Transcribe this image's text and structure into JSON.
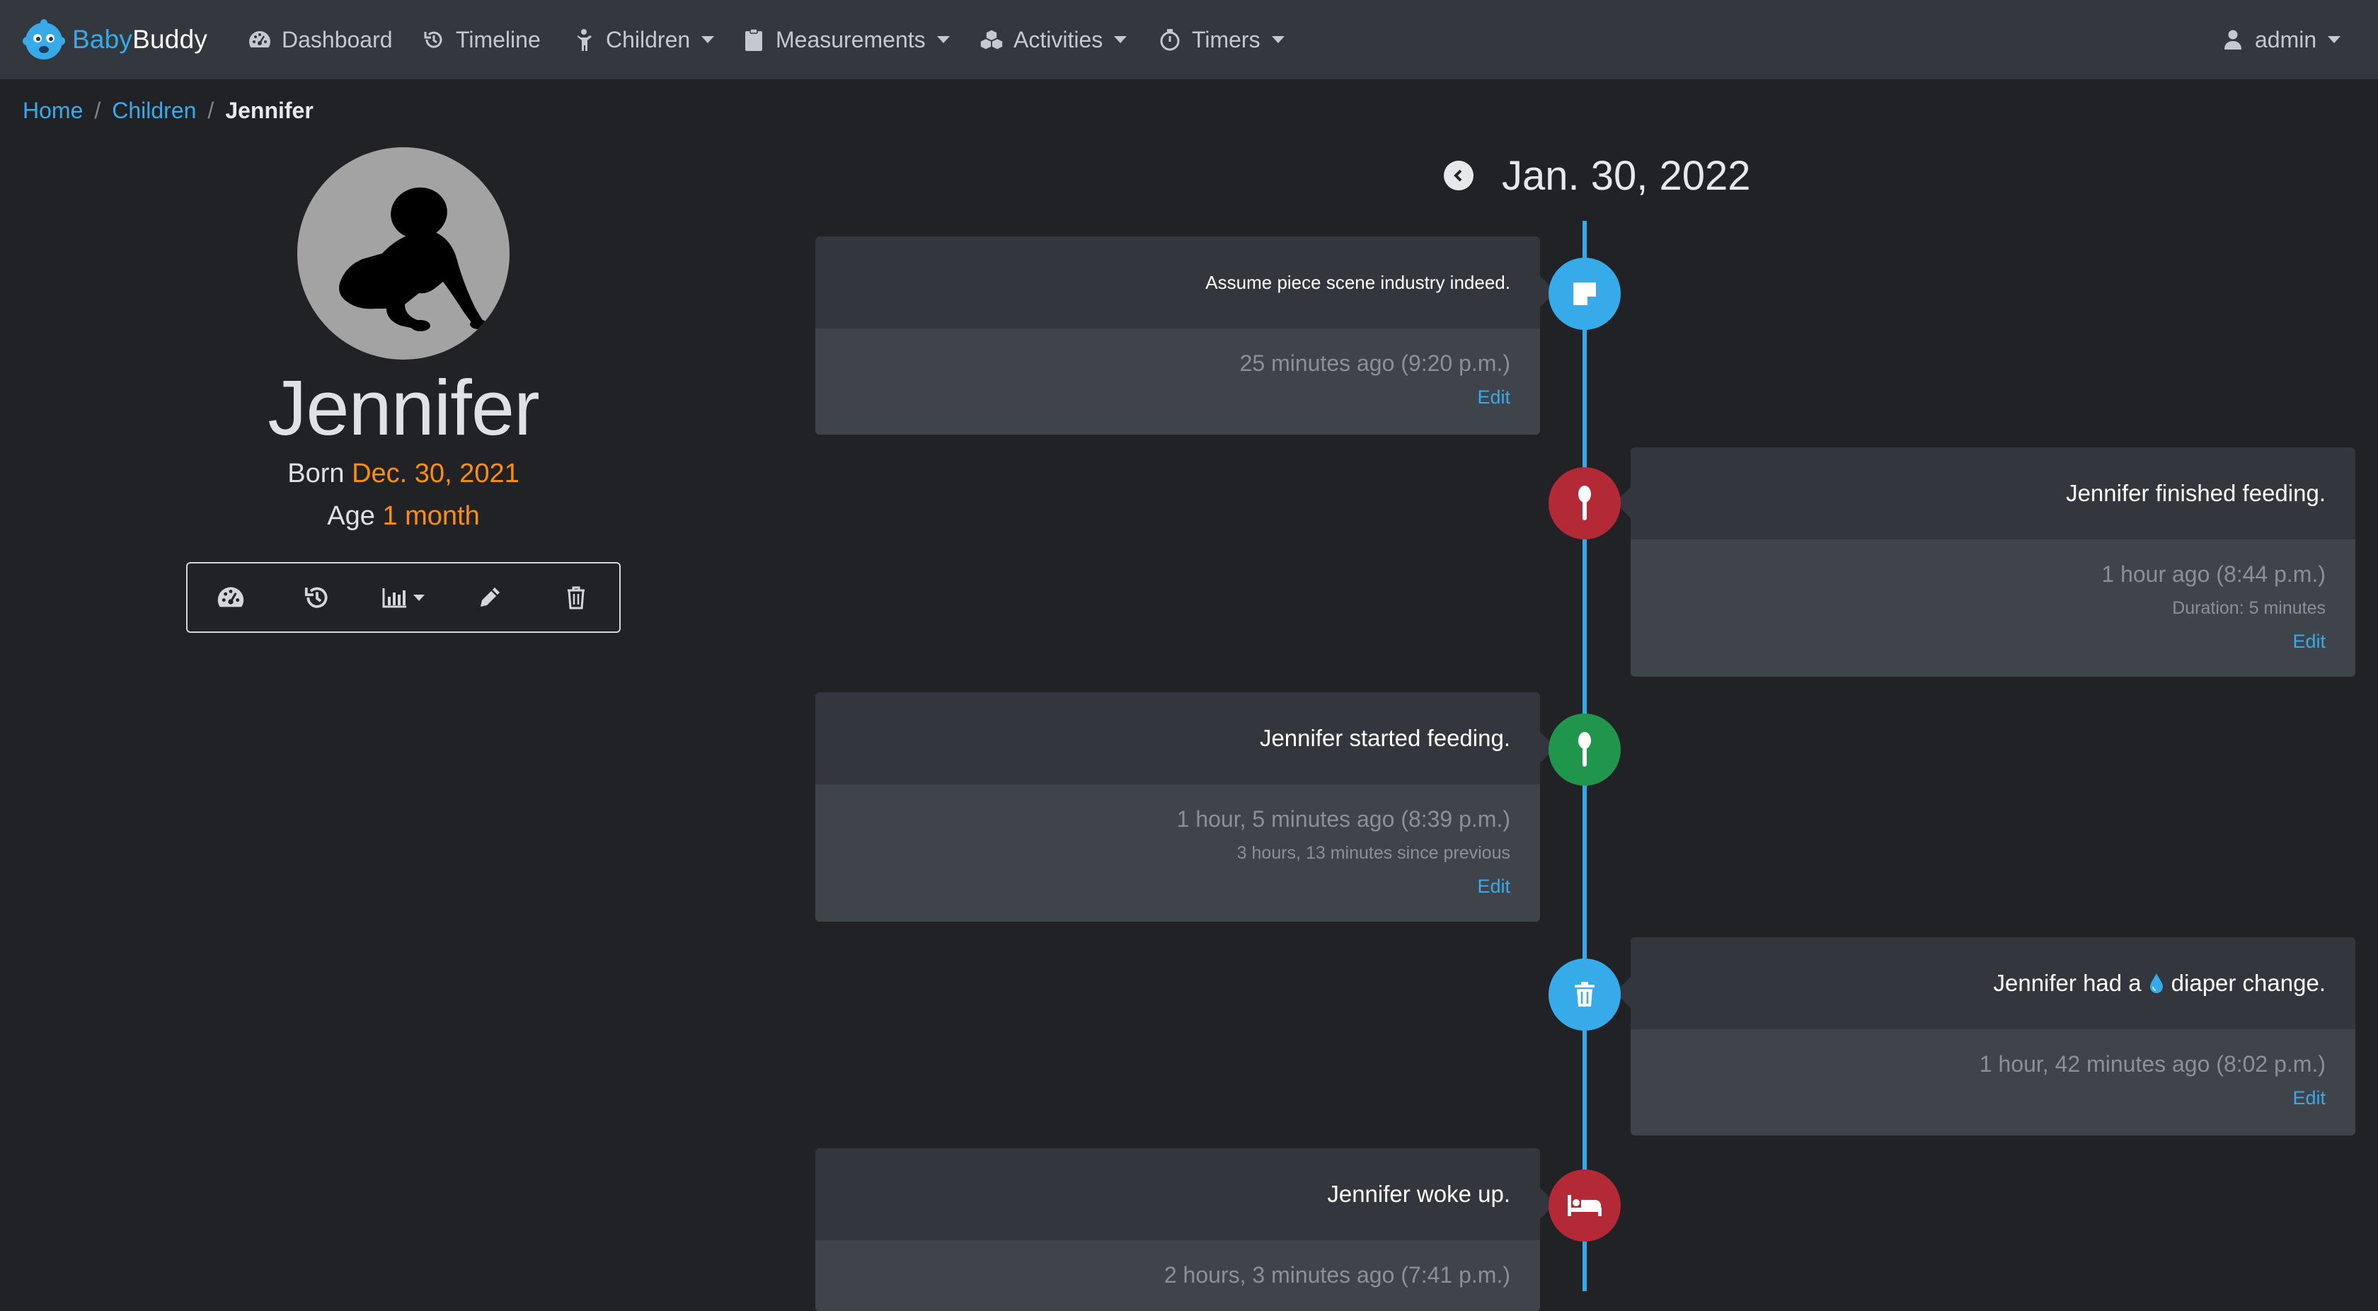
{
  "brand": {
    "baby": "Baby",
    "buddy": "Buddy"
  },
  "nav": {
    "dashboard": "Dashboard",
    "timeline": "Timeline",
    "children": "Children",
    "measurements": "Measurements",
    "activities": "Activities",
    "timers": "Timers",
    "user": "admin"
  },
  "breadcrumb": {
    "home": "Home",
    "children": "Children",
    "current": "Jennifer"
  },
  "child": {
    "name": "Jennifer",
    "born_label": "Born",
    "born_date": "Dec. 30, 2021",
    "age_label": "Age",
    "age_value": "1 month"
  },
  "timeline": {
    "date": "Jan. 30, 2022",
    "entries": [
      {
        "text": "Assume piece scene industry indeed.",
        "time": "25 minutes ago (9:20 p.m.)",
        "edit": "Edit",
        "icon": "note-icon",
        "color": "#37abe9"
      },
      {
        "text": "Jennifer finished feeding.",
        "time": "1 hour ago (8:44 p.m.)",
        "detail": "Duration: 5 minutes",
        "edit": "Edit",
        "icon": "spoon-icon",
        "color": "#b32a36"
      },
      {
        "text": "Jennifer started feeding.",
        "time": "1 hour, 5 minutes ago (8:39 p.m.)",
        "detail": "3 hours, 13 minutes since previous",
        "edit": "Edit",
        "icon": "spoon-icon",
        "color": "#20964c"
      },
      {
        "text_before": "Jennifer had a",
        "text_after": "diaper change.",
        "time": "1 hour, 42 minutes ago (8:02 p.m.)",
        "edit": "Edit",
        "icon": "trash-icon",
        "drop_icon": "water-drop-icon",
        "color": "#37abe9"
      },
      {
        "text": "Jennifer woke up.",
        "time": "2 hours, 3 minutes ago (7:41 p.m.)",
        "icon": "bed-icon",
        "color": "#b32a36"
      }
    ]
  },
  "colors": {
    "accent": "#37abe9",
    "highlight": "#ff8f00",
    "navbar": "#33373e",
    "background": "#202226"
  }
}
